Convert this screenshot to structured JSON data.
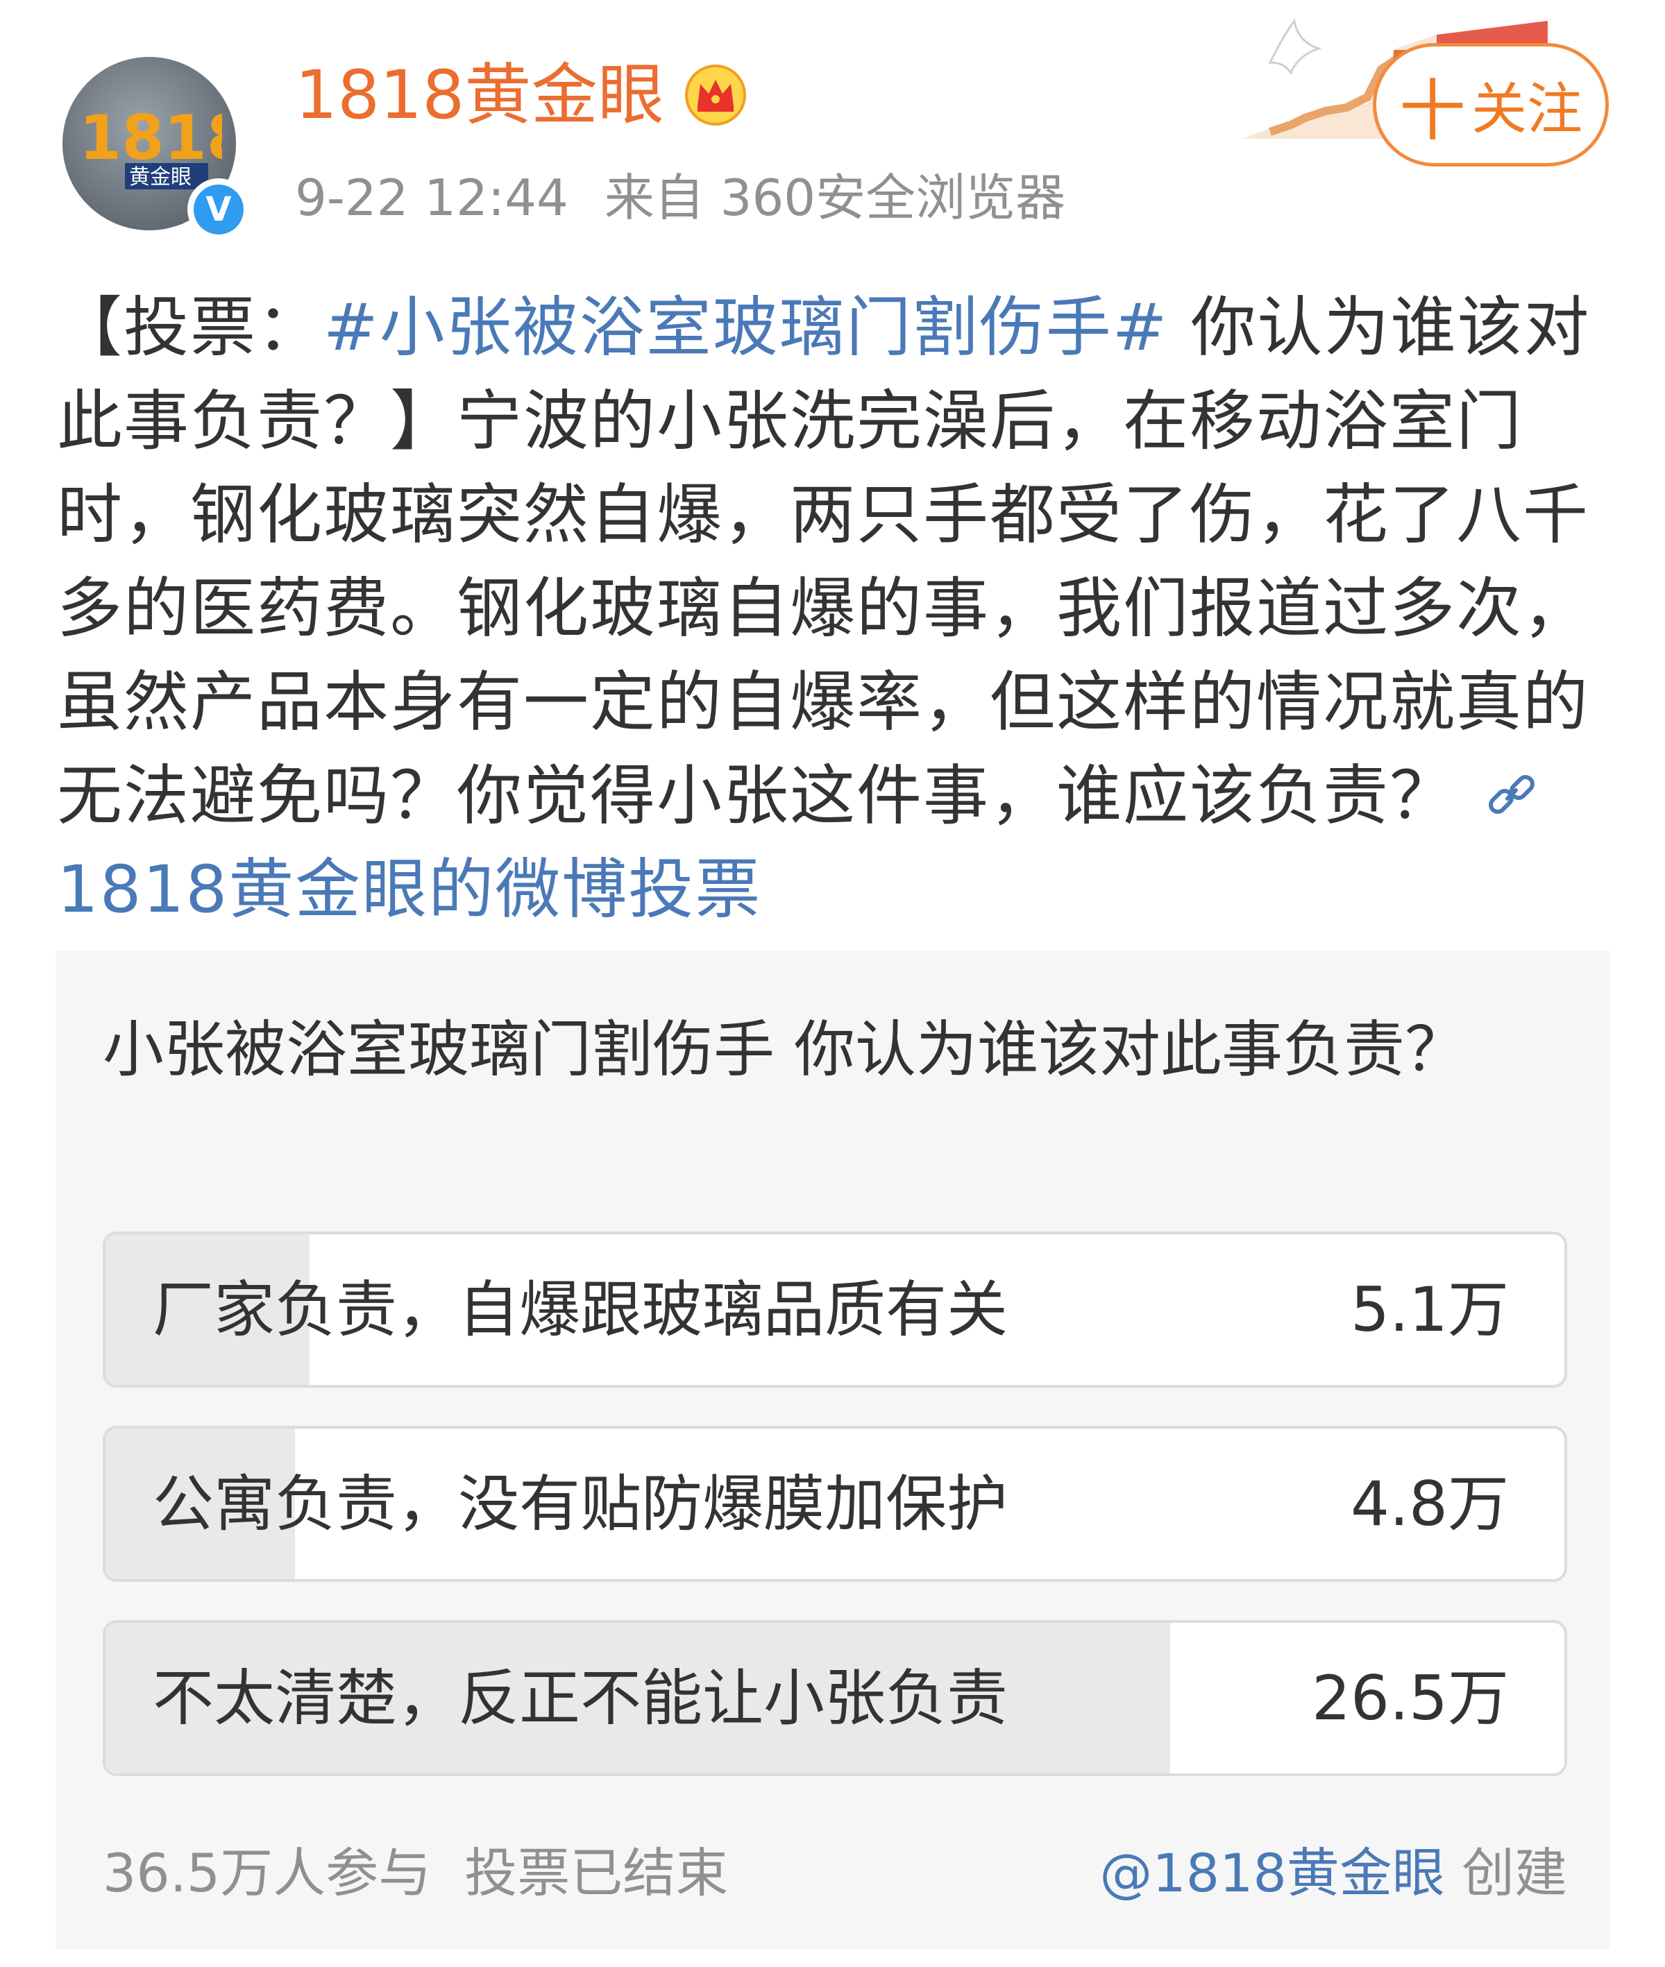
{
  "post": {
    "username": "1818黄金眼",
    "time": "9-22 12:44",
    "source": "来自 360安全浏览器",
    "follow_label": "关注",
    "follow_plus": "十",
    "verified_mark": "V",
    "avatar_text": "1818",
    "avatar_subtext": "黄金眼",
    "text_prefix": "【投票：",
    "hashtag": "#小张被浴室玻璃门割伤手#",
    "text_body": "你认为谁该对此事负责？】宁波的小张洗完澡后，在移动浴室门时，钢化玻璃突然自爆，两只手都受了伤，花了八千多的医药费。钢化玻璃自爆的事，我们报道过多次，虽然产品本身有一定的自爆率，但这样的情况就真的无法避免吗？你觉得小张这件事，谁应该负责？",
    "vote_link": "1818黄金眼的微博投票"
  },
  "vote": {
    "question": "小张被浴室玻璃门割伤手 你认为谁该对此事负责？",
    "options": [
      {
        "label": "厂家负责，自爆跟玻璃品质有关",
        "count": "5.1万",
        "share": 0.14
      },
      {
        "label": "公寓负责，没有贴防爆膜加保护",
        "count": "4.8万",
        "share": 0.13
      },
      {
        "label": "不太清楚，反正不能让小张负责",
        "count": "26.5万",
        "share": 0.73
      }
    ],
    "participants": "36.5万人参与",
    "status": "投票已结束",
    "creator_handle": "@1818黄金眼",
    "creator_suffix": " 创建"
  },
  "colors": {
    "username": "#eb6d2f",
    "link": "#4a79b7",
    "follow": "#f07a23",
    "verified": "#2f9cf0"
  },
  "icons": {
    "crown": "crown-icon",
    "verified": "verified-icon",
    "link": "link-icon",
    "decoration": "dove-greatwall-icon"
  }
}
